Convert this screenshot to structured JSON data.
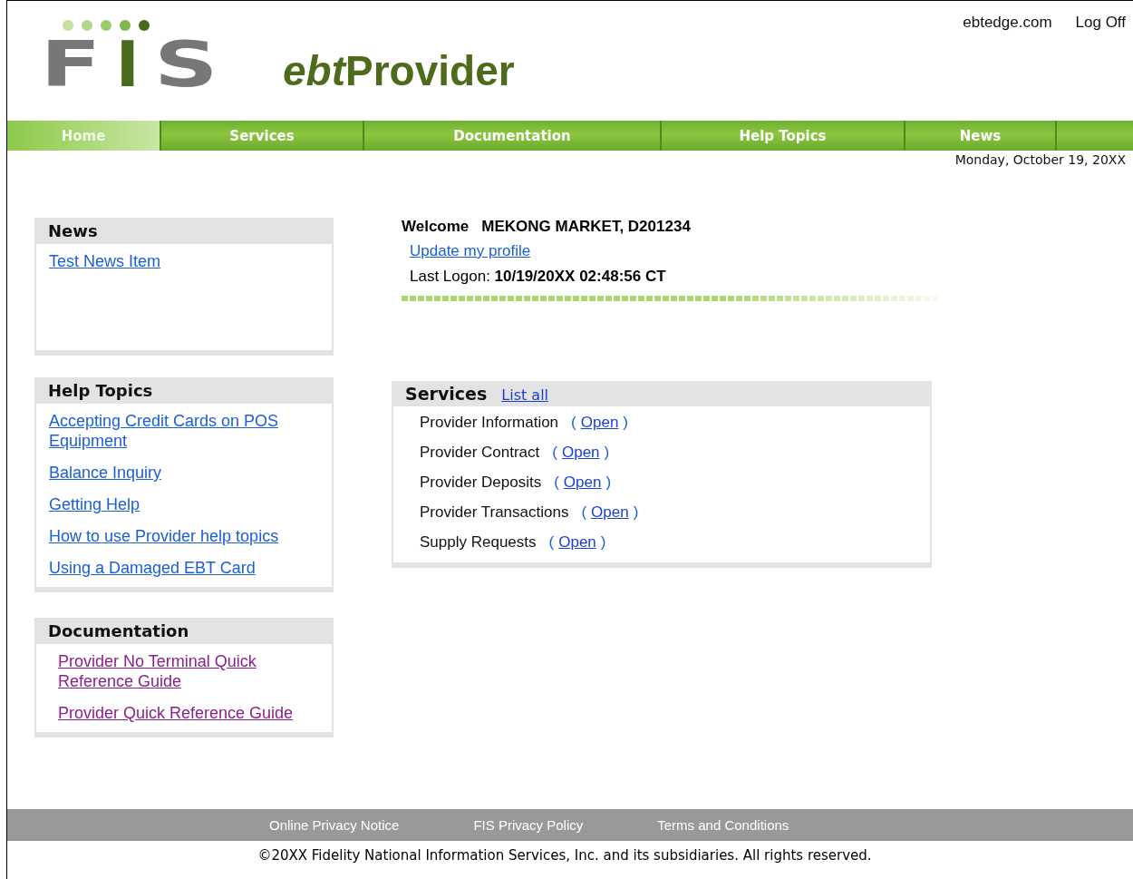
{
  "header": {
    "logo": "FIS",
    "brand_italic": "ebt",
    "brand_rest": "Provider",
    "top_links": [
      "ebtedge.com",
      "Log Off"
    ]
  },
  "nav": [
    {
      "label": "Home",
      "selected": true
    },
    {
      "label": "Services",
      "selected": false
    },
    {
      "label": "Documentation",
      "selected": false
    },
    {
      "label": "Help Topics",
      "selected": false
    },
    {
      "label": "News",
      "selected": false
    }
  ],
  "date": "Monday, October 19, 20XX",
  "sidebar": [
    {
      "title": "News",
      "links": [
        {
          "label": "Test News Item",
          "visited": false
        }
      ]
    },
    {
      "title": "Help Topics",
      "links": [
        {
          "label": "Accepting Credit Cards on POS Equipment",
          "visited": false
        },
        {
          "label": "Balance Inquiry",
          "visited": false
        },
        {
          "label": "Getting Help",
          "visited": false
        },
        {
          "label": "How to use Provider help topics",
          "visited": false
        },
        {
          "label": "Using a Damaged EBT Card",
          "visited": false
        }
      ]
    },
    {
      "title": "Documentation",
      "links": [
        {
          "label": "Provider No Terminal Quick Reference Guide",
          "visited": true
        },
        {
          "label": "Provider Quick Reference Guide",
          "visited": true
        }
      ]
    }
  ],
  "welcome": {
    "label": "Welcome",
    "name": "MEKONG MARKET, D201234",
    "profile_link": "Update my profile",
    "last_logon": "Last Logon: **10/19/20XX 02:48:56 CT**"
  },
  "services": {
    "title": "Services",
    "list_all": "List all",
    "items": [
      {
        "name": "Provider Information",
        "paren_open": "(",
        "link": "Open",
        "paren_close": ")"
      },
      {
        "name": "Provider Contract",
        "paren_open": "(",
        "link": "Open",
        "paren_close": ")"
      },
      {
        "name": "Provider Deposits",
        "paren_open": "(",
        "link": "Open",
        "paren_close": ")"
      },
      {
        "name": "Provider Transactions",
        "paren_open": "(",
        "link": "Open",
        "paren_close": ")"
      },
      {
        "name": "Supply Requests",
        "paren_open": "(",
        "link": "Open",
        "paren_close": ")"
      }
    ]
  },
  "footer": {
    "links": [
      "Online Privacy Notice",
      "FIS Privacy Policy",
      "Terms and Conditions"
    ],
    "copyright": "©20XX Fidelity National Information Services, Inc. and its subsidiaries. All rights reserved."
  }
}
